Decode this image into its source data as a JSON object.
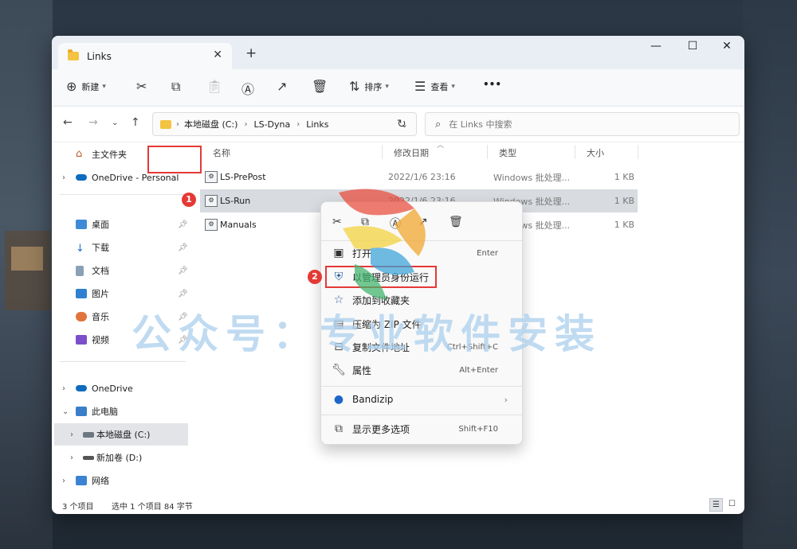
{
  "window": {
    "tab_title": "Links",
    "tab_close": "✕",
    "new_tab": "+",
    "minimize": "—",
    "maximize": "☐",
    "close": "✕"
  },
  "toolbar": {
    "new_label": "新建",
    "sort_label": "排序",
    "view_label": "查看",
    "more": "•••"
  },
  "address": {
    "crumbs": [
      "本地磁盘 (C:)",
      "LS-Dyna",
      "Links"
    ],
    "search_placeholder": "在 Links 中搜索"
  },
  "sidebar": {
    "items": [
      {
        "label": "主文件夹"
      },
      {
        "label": "OneDrive - Personal"
      },
      {
        "label": "桌面"
      },
      {
        "label": "下载"
      },
      {
        "label": "文档"
      },
      {
        "label": "图片"
      },
      {
        "label": "音乐"
      },
      {
        "label": "视频"
      },
      {
        "label": "OneDrive"
      },
      {
        "label": "此电脑"
      },
      {
        "label": "本地磁盘 (C:)"
      },
      {
        "label": "新加卷 (D:)"
      },
      {
        "label": "网络"
      }
    ]
  },
  "columns": {
    "name": "名称",
    "modified": "修改日期",
    "type": "类型",
    "size": "大小"
  },
  "files": [
    {
      "name": "LS-PrePost",
      "date": "2022/1/6 23:16",
      "type": "Windows 批处理...",
      "size": "1 KB"
    },
    {
      "name": "LS-Run",
      "date": "2022/1/6 23:16",
      "type": "Windows 批处理...",
      "size": "1 KB"
    },
    {
      "name": "Manuals",
      "date": "",
      "type": "Windows 批处理...",
      "size": "1 KB"
    }
  ],
  "context_menu": {
    "items": [
      {
        "label": "打开",
        "key": "Enter"
      },
      {
        "label": "以管理员身份运行",
        "key": ""
      },
      {
        "label": "添加到收藏夹",
        "key": ""
      },
      {
        "label": "压缩为 ZIP 文件",
        "key": ""
      },
      {
        "label": "复制文件地址",
        "key": "Ctrl+Shift+C"
      },
      {
        "label": "属性",
        "key": "Alt+Enter"
      },
      {
        "label": "Bandizip",
        "key": ""
      },
      {
        "label": "显示更多选项",
        "key": "Shift+F10"
      }
    ]
  },
  "badges": [
    "1",
    "2"
  ],
  "status": {
    "count": "3 个项目",
    "selection": "选中 1 个项目  84 字节"
  },
  "watermark": "公众号：专业软件安装",
  "colors": {
    "accent": "#e53935",
    "selection": "#d8dbe0",
    "folder": "#f5c342",
    "onedrive": "#0f6cbd"
  }
}
